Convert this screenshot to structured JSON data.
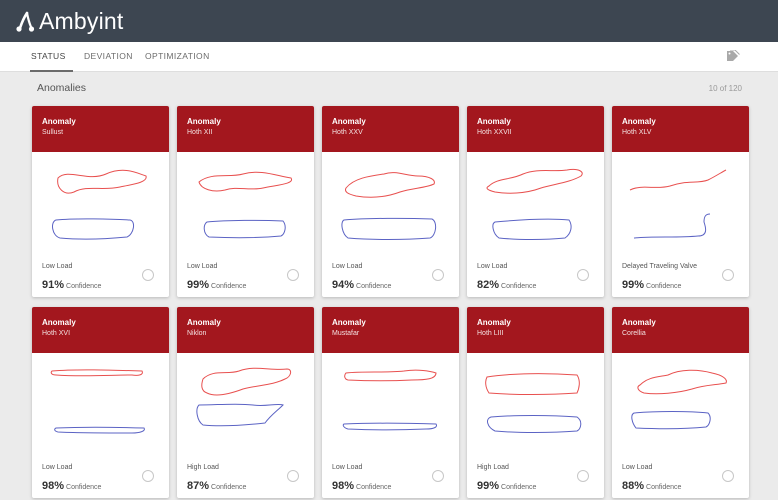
{
  "app": {
    "title": "Ambyint"
  },
  "tabs": [
    {
      "label": "STATUS",
      "active": true
    },
    {
      "label": "DEVIATION",
      "active": false
    },
    {
      "label": "OPTIMIZATION",
      "active": false
    }
  ],
  "header_icon": "tag-icon",
  "section": {
    "title": "Anomalies",
    "count": "10 of 120"
  },
  "cards": [
    {
      "title": "Anomaly",
      "subtitle": "Sullust",
      "status": "Low Load",
      "confidence": "91%",
      "confidence_label": "Confidence"
    },
    {
      "title": "Anomaly",
      "subtitle": "Hoth XII",
      "status": "Low Load",
      "confidence": "99%",
      "confidence_label": "Confidence"
    },
    {
      "title": "Anomaly",
      "subtitle": "Hoth XXV",
      "status": "Low Load",
      "confidence": "94%",
      "confidence_label": "Confidence"
    },
    {
      "title": "Anomaly",
      "subtitle": "Hoth XXVII",
      "status": "Low Load",
      "confidence": "82%",
      "confidence_label": "Confidence"
    },
    {
      "title": "Anomaly",
      "subtitle": "Hoth XLV",
      "status": "Delayed Traveling Valve",
      "confidence": "99%",
      "confidence_label": "Confidence"
    },
    {
      "title": "Anomaly",
      "subtitle": "Hoth XVI",
      "status": "Low Load",
      "confidence": "98%",
      "confidence_label": "Confidence"
    },
    {
      "title": "Anomaly",
      "subtitle": "Niklon",
      "status": "High Load",
      "confidence": "87%",
      "confidence_label": "Confidence"
    },
    {
      "title": "Anomaly",
      "subtitle": "Mustafar",
      "status": "Low Load",
      "confidence": "98%",
      "confidence_label": "Confidence"
    },
    {
      "title": "Anomaly",
      "subtitle": "Hoth LIII",
      "status": "High Load",
      "confidence": "99%",
      "confidence_label": "Confidence"
    },
    {
      "title": "Anomaly",
      "subtitle": "Corellia",
      "status": "Low Load",
      "confidence": "88%",
      "confidence_label": "Confidence"
    }
  ],
  "colors": {
    "topbar": "#3d4651",
    "card_header": "#a3171e",
    "surface_line": "#e8504f",
    "pump_line": "#5b63c4",
    "background": "#ebebeb"
  }
}
